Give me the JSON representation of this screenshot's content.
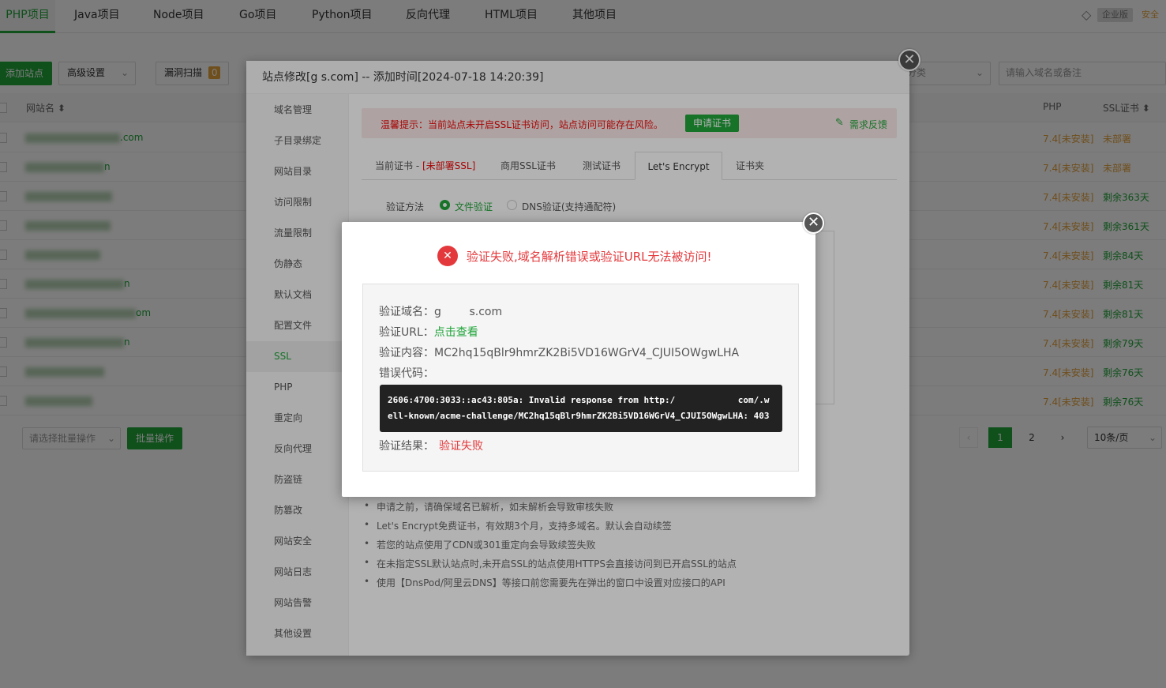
{
  "topnav": {
    "tabs": [
      "PHP项目",
      "Java项目",
      "Node项目",
      "Go项目",
      "Python项目",
      "反向代理",
      "HTML项目",
      "其他项目"
    ],
    "badge_enterprise": "企业版",
    "badge_security": "安全"
  },
  "toolbar": {
    "add_site": "添加站点",
    "advanced": "高级设置",
    "scan": "漏洞扫描",
    "scan_count": "0",
    "category": "分类",
    "search_placeholder": "请输入域名或备注"
  },
  "table": {
    "headers": {
      "site": "网站名 ⬍",
      "php": "PHP",
      "ssl": "SSL证书 ⬍"
    },
    "rows": [
      {
        "name_tail": ".com",
        "php": "7.4[未安装]",
        "ssl": "未部署",
        "ssl_status": "warn"
      },
      {
        "name_tail": "n",
        "php": "7.4[未安装]",
        "ssl": "未部署",
        "ssl_status": "warn"
      },
      {
        "name_tail": "",
        "php": "7.4[未安装]",
        "ssl": "剩余363天",
        "ssl_status": "ok"
      },
      {
        "name_tail": "",
        "php": "7.4[未安装]",
        "ssl": "剩余361天",
        "ssl_status": "ok"
      },
      {
        "name_tail": "",
        "php": "7.4[未安装]",
        "ssl": "剩余84天",
        "ssl_status": "ok"
      },
      {
        "name_tail": "n",
        "php": "7.4[未安装]",
        "ssl": "剩余81天",
        "ssl_status": "ok"
      },
      {
        "name_tail": "om",
        "php": "7.4[未安装]",
        "ssl": "剩余81天",
        "ssl_status": "ok"
      },
      {
        "name_tail": "n",
        "php": "7.4[未安装]",
        "ssl": "剩余79天",
        "ssl_status": "ok"
      },
      {
        "name_tail": "",
        "php": "7.4[未安装]",
        "ssl": "剩余76天",
        "ssl_status": "ok"
      },
      {
        "name_tail": "",
        "php": "7.4[未安装]",
        "ssl": "剩余76天",
        "ssl_status": "ok"
      }
    ],
    "batch_select": "请选择批量操作",
    "batch_btn": "批量操作",
    "pages": [
      "1",
      "2"
    ],
    "page_size": "10条/页"
  },
  "dialog": {
    "title": "站点修改[g        s.com] -- 添加时间[2024-07-18 14:20:39]",
    "side": [
      "域名管理",
      "子目录绑定",
      "网站目录",
      "访问限制",
      "流量限制",
      "伪静态",
      "默认文档",
      "配置文件",
      "SSL",
      "PHP",
      "重定向",
      "反向代理",
      "防盗链",
      "防篡改",
      "网站安全",
      "网站日志",
      "网站告警",
      "其他设置"
    ],
    "active_side": "SSL",
    "warning": "温馨提示：当前站点未开启SSL证书访问，站点访问可能存在风险。",
    "apply_btn": "申请证书",
    "feedback": "需求反馈",
    "tabs": {
      "current_prefix": "当前证书 - ",
      "current_suffix": "[未部署SSL]",
      "commercial": "商用SSL证书",
      "test": "测试证书",
      "letsencrypt": "Let's Encrypt",
      "folder": "证书夹"
    },
    "verify_label": "验证方法",
    "verify_file": "文件验证",
    "verify_dns": "DNS验证(支持通配符)",
    "tips": [
      "申请之前，请确保域名已解析，如未解析会导致审核失败",
      "Let's Encrypt免费证书，有效期3个月，支持多域名。默认会自动续签",
      "若您的站点使用了CDN或301重定向会导致续签失败",
      "在未指定SSL默认站点时,未开启SSL的站点使用HTTPS会直接访问到已开启SSL的站点",
      "使用【DnsPod/阿里云DNS】等接口前您需要先在弹出的窗口中设置对应接口的API"
    ]
  },
  "error": {
    "title": "验证失败,域名解析错误或验证URL无法被访问!",
    "domain_label": "验证域名：",
    "domain_value": "g        s.com",
    "url_label": "验证URL：",
    "url_value": "点击查看",
    "content_label": "验证内容：",
    "content_value": "MC2hq15qBlr9hmrZK2Bi5VD16WGrV4_CJUI5OWgwLHA",
    "code_label": "错误代码：",
    "code_text": "2606:4700:3033::ac43:805a: Invalid response from http:/            com/.w\nell-known/acme-challenge/MC2hq15qBlr9hmrZK2Bi5VD16WGrV4_CJUI5OWgwLHA: 403",
    "result_label": "验证结果：",
    "result_value": "验证失败"
  },
  "colors": {
    "accent": "#20a53a",
    "danger": "#e4393c",
    "warning_text": "#ef0808"
  }
}
